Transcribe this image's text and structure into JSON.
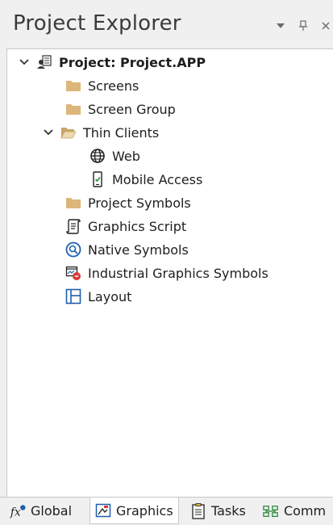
{
  "panel": {
    "title": "Project Explorer",
    "controls": {
      "dropdown_icon": "dropdown-arrow-icon",
      "pin_icon": "pin-icon",
      "close_icon": "close-icon"
    }
  },
  "tree": {
    "root": {
      "label": "Project: Project.APP",
      "icon": "project-icon",
      "expanded": true
    },
    "items": [
      {
        "label": "Screens",
        "icon": "folder-icon"
      },
      {
        "label": "Screen Group",
        "icon": "folder-icon"
      },
      {
        "label": "Thin Clients",
        "icon": "folder-open-icon",
        "expanded": true,
        "children": [
          {
            "label": "Web",
            "icon": "globe-icon"
          },
          {
            "label": "Mobile Access",
            "icon": "mobile-icon"
          }
        ]
      },
      {
        "label": "Project Symbols",
        "icon": "folder-icon"
      },
      {
        "label": "Graphics Script",
        "icon": "script-icon"
      },
      {
        "label": "Native Symbols",
        "icon": "native-symbols-icon"
      },
      {
        "label": "Industrial Graphics Symbols",
        "icon": "industrial-graphics-icon"
      },
      {
        "label": "Layout",
        "icon": "layout-icon"
      }
    ]
  },
  "tabs": [
    {
      "label": "Global",
      "icon": "fx-icon",
      "active": false
    },
    {
      "label": "Graphics",
      "icon": "graphics-icon",
      "active": true
    },
    {
      "label": "Tasks",
      "icon": "tasks-icon",
      "active": false
    },
    {
      "label": "Comm",
      "icon": "comm-icon",
      "active": false
    }
  ],
  "colors": {
    "folder": "#dcb67a",
    "accent_blue": "#1e5fae",
    "panel_bg": "#f0f0f0",
    "tree_bg": "#ffffff"
  }
}
